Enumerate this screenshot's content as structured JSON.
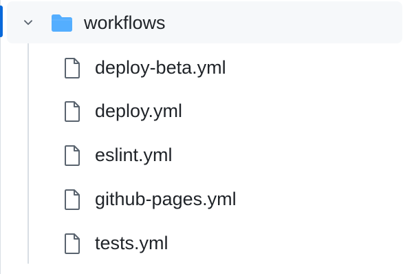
{
  "tree": {
    "folder": {
      "label": "workflows",
      "expanded": true,
      "icon": "folder-icon",
      "color": "#54aeff"
    },
    "files": [
      {
        "label": "deploy-beta.yml",
        "icon": "file-icon"
      },
      {
        "label": "deploy.yml",
        "icon": "file-icon"
      },
      {
        "label": "eslint.yml",
        "icon": "file-icon"
      },
      {
        "label": "github-pages.yml",
        "icon": "file-icon"
      },
      {
        "label": "tests.yml",
        "icon": "file-icon"
      }
    ]
  },
  "colors": {
    "accent": "#0969da",
    "row_hover": "#f6f8fa",
    "icon": "#59636e",
    "text": "#1f2328"
  }
}
